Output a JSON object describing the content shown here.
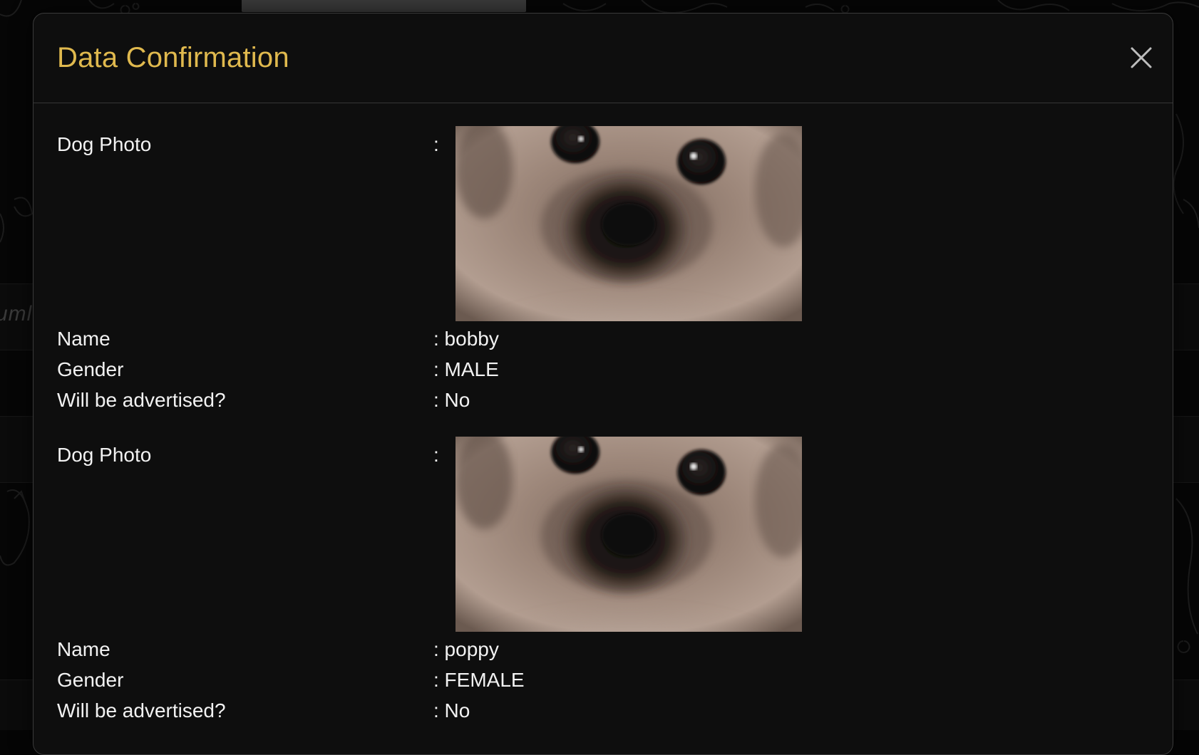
{
  "modal": {
    "title": "Data Confirmation",
    "close_icon": "close-icon",
    "separator": ":",
    "colors": {
      "title": "#e0b94e",
      "text": "#f2f2f2",
      "panel": "#0e0e0e",
      "border": "#3a3a3a"
    }
  },
  "background": {
    "ghost_text": "uml"
  },
  "entries": [
    {
      "photo_label": "Dog Photo",
      "photo_icon": "dog-photo",
      "name_label": "Name",
      "name_value": ": bobby",
      "gender_label": "Gender",
      "gender_value": ": MALE",
      "advertised_label": "Will be advertised?",
      "advertised_value": ": No"
    },
    {
      "photo_label": "Dog Photo",
      "photo_icon": "dog-photo",
      "name_label": "Name",
      "name_value": ": poppy",
      "gender_label": "Gender",
      "gender_value": ": FEMALE",
      "advertised_label": "Will be advertised?",
      "advertised_value": ": No"
    }
  ]
}
